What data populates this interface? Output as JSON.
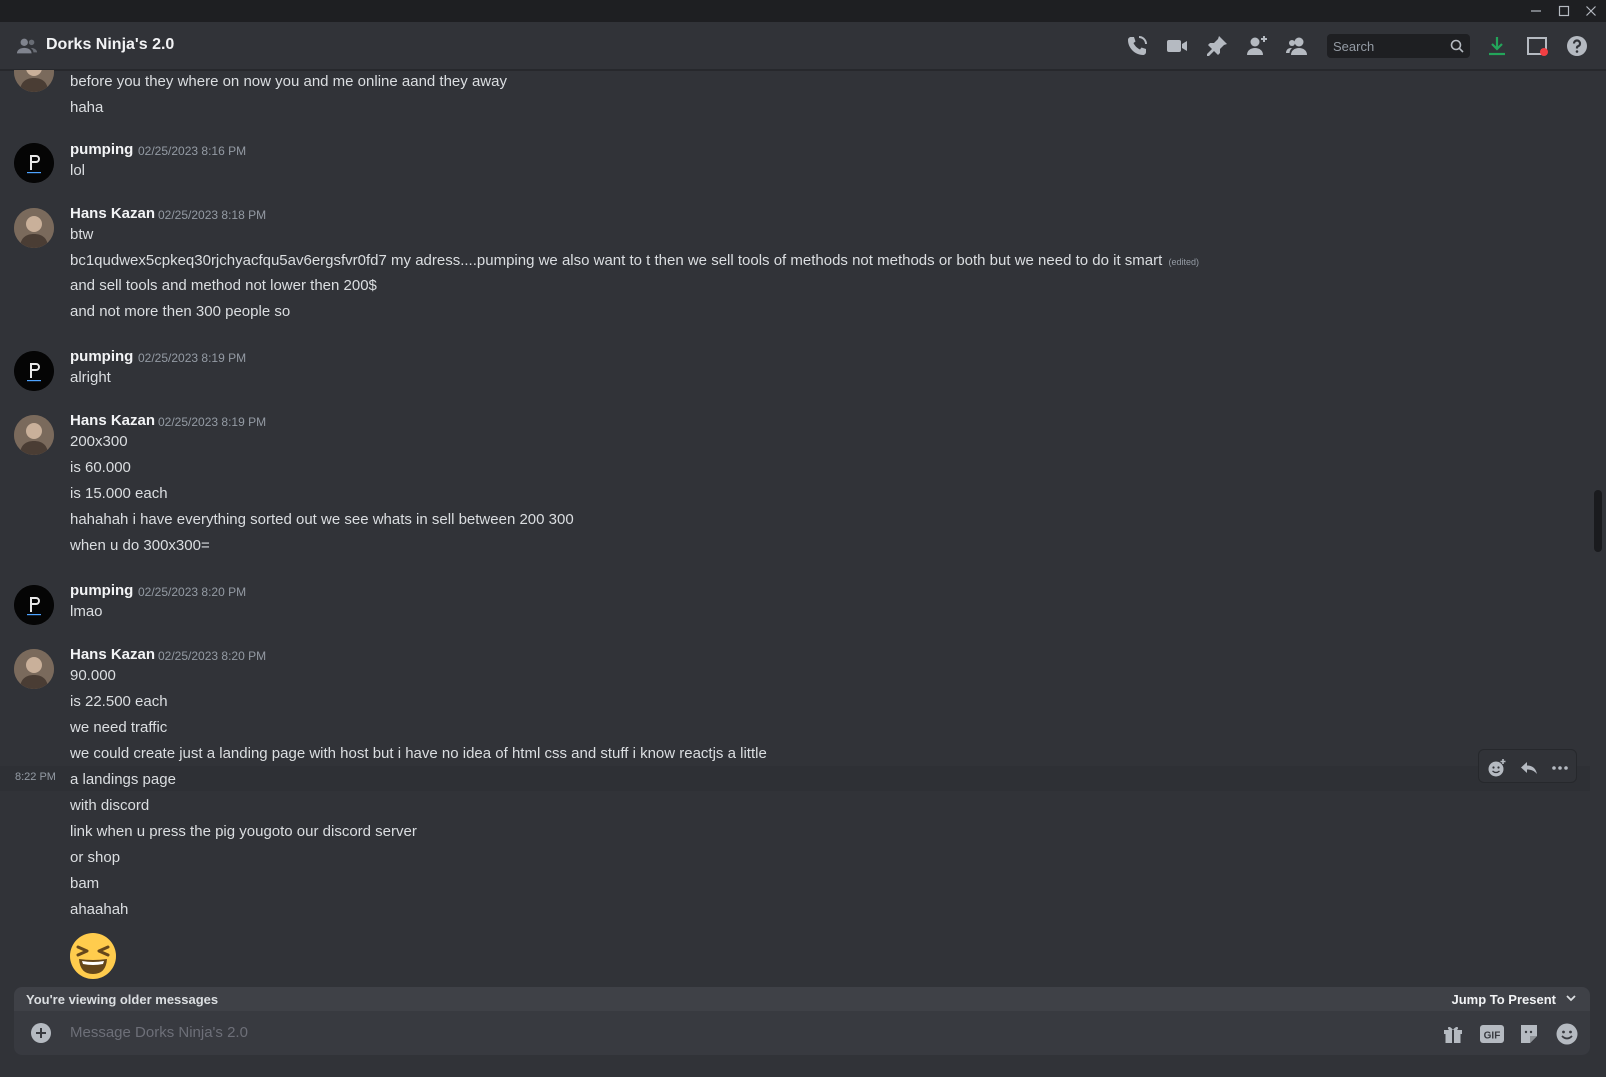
{
  "window": {
    "minimize_icon": "minimize-icon",
    "maximize_icon": "maximize-icon",
    "close_icon": "close-icon"
  },
  "header": {
    "title": "Dorks Ninja's 2.0",
    "search_placeholder": "Search",
    "icons": [
      "call-icon",
      "video-icon",
      "pin-icon",
      "add-member-icon",
      "member-list-icon",
      "search-icon",
      "download-icon",
      "inbox-icon",
      "help-icon"
    ],
    "download_color": "#23a55a",
    "inbox_badge_color": "#f23f43"
  },
  "messages": [
    {
      "lines": [
        "before you they where on now you and me online aand they away",
        "haha"
      ]
    },
    {
      "author": "pumping",
      "time": "02/25/2023 8:16 PM",
      "lines": [
        "lol"
      ]
    },
    {
      "author": "Hans Kazan",
      "time": "02/25/2023 8:18 PM",
      "lines": [
        "btw",
        "bc1qudwex5cpkeq30rjchyacfqu5av6ergsfvr0fd7 my adress....pumping we also want to t then we sell tools of methods not methods or both but we need to do it smart",
        "and sell tools and method not lower then 200$",
        "and not more then 300 people so"
      ],
      "edited_label": "(edited)"
    },
    {
      "author": "pumping",
      "time": "02/25/2023 8:19 PM",
      "lines": [
        "alright"
      ]
    },
    {
      "author": "Hans Kazan",
      "time": "02/25/2023 8:19 PM",
      "lines": [
        "200x300",
        "is 60.000",
        "is 15.000 each",
        "hahahah i have everything sorted out we see whats in sell between 200 300",
        "when u do 300x300="
      ]
    },
    {
      "author": "pumping",
      "time": "02/25/2023 8:20 PM",
      "lines": [
        "lmao"
      ]
    },
    {
      "author": "Hans Kazan",
      "time": "02/25/2023 8:20 PM",
      "lines": [
        "90.000",
        "is 22.500 each",
        "we need traffic",
        "we could create just a landing page with host but i have no idea of html css and stuff i know reactjs a little",
        "a landings page",
        "with discord",
        "link when u press the pig yougoto our discord server",
        "or shop",
        "bam",
        "ahaahah"
      ],
      "hover_time": "8:22 PM",
      "emoji": "laughing-emoji"
    }
  ],
  "toolbar": {
    "icons": [
      "add-reaction-icon",
      "reply-icon",
      "more-icon"
    ]
  },
  "older_bar": {
    "text": "You're viewing older messages",
    "jump": "Jump To Present"
  },
  "composer": {
    "placeholder": "Message Dorks Ninja's 2.0",
    "icons": [
      "add-attachment-icon",
      "gift-icon",
      "gif-icon",
      "sticker-icon",
      "emoji-icon"
    ],
    "gif_label": "GIF"
  }
}
